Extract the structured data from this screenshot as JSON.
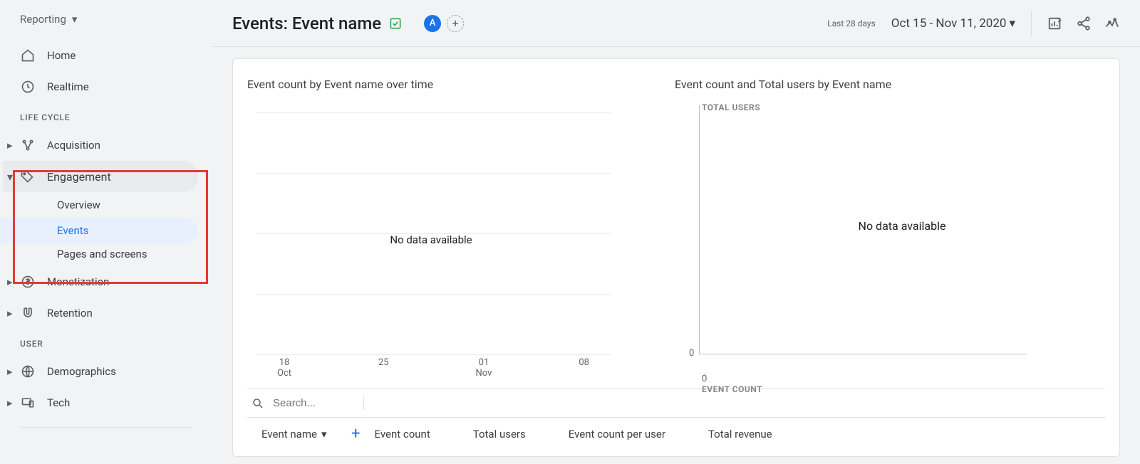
{
  "sidebar": {
    "reporting_label": "Reporting",
    "home": "Home",
    "realtime": "Realtime",
    "life_cycle_label": "LIFE CYCLE",
    "acquisition": "Acquisition",
    "engagement": "Engagement",
    "engagement_sub": {
      "overview": "Overview",
      "events": "Events",
      "pages_screens": "Pages and screens"
    },
    "monetization": "Monetization",
    "retention": "Retention",
    "user_label": "USER",
    "demographics": "Demographics",
    "tech": "Tech"
  },
  "header": {
    "title": "Events: Event name",
    "avatar_letter": "A",
    "date_prefix": "Last 28 days",
    "date_range": "Oct 15 - Nov 11, 2020"
  },
  "charts": {
    "left_title": "Event count by Event name over time",
    "right_title": "Event count and Total users by Event name",
    "no_data": "No data available",
    "right_y_label": "TOTAL USERS",
    "right_x_label": "EVENT COUNT",
    "zero": "0",
    "left_ticks": [
      {
        "top": "18",
        "bottom": "Oct"
      },
      {
        "top": "25",
        "bottom": ""
      },
      {
        "top": "01",
        "bottom": "Nov"
      },
      {
        "top": "08",
        "bottom": ""
      }
    ]
  },
  "table": {
    "search_placeholder": "Search...",
    "col_event_name": "Event name",
    "col_event_count": "Event count",
    "col_total_users": "Total users",
    "col_per_user": "Event count per user",
    "col_revenue": "Total revenue"
  },
  "chart_data": [
    {
      "type": "line",
      "title": "Event count by Event name over time",
      "x": [
        "18 Oct",
        "25 Oct",
        "01 Nov",
        "08 Nov"
      ],
      "series": [],
      "note": "No data available",
      "xlabel": "",
      "ylabel": "Event count"
    },
    {
      "type": "scatter",
      "title": "Event count and Total users by Event name",
      "x": [],
      "y": [],
      "xlabel": "EVENT COUNT",
      "ylabel": "TOTAL USERS",
      "xlim": [
        0,
        null
      ],
      "ylim": [
        0,
        null
      ],
      "note": "No data available"
    }
  ]
}
